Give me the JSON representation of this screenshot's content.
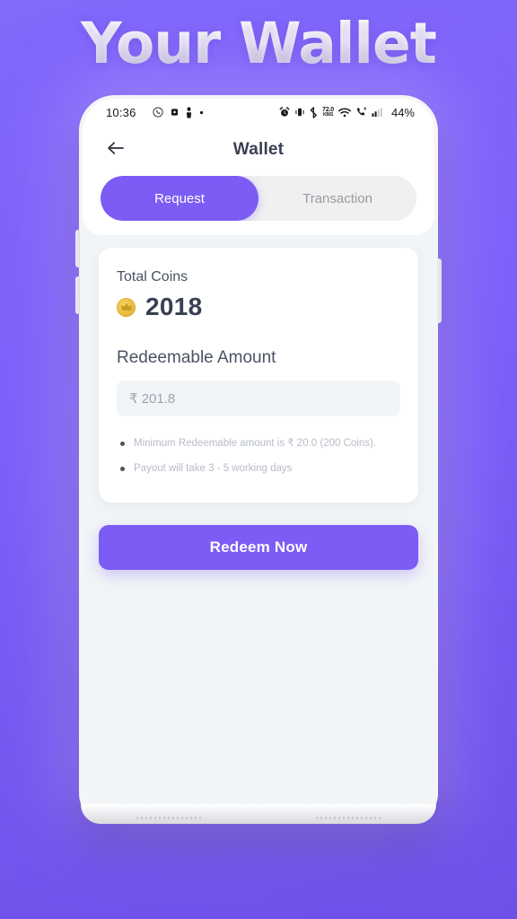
{
  "hero": {
    "title": "Your Wallet"
  },
  "status_bar": {
    "time": "10:36",
    "left_icons": [
      "whatsapp-icon",
      "app-icon",
      "app-icon-2",
      "dot-icon"
    ],
    "network_speed_value": "72.0",
    "network_speed_unit": "KB/S",
    "right_icons": [
      "alarm-icon",
      "vibrate-icon",
      "bluetooth-icon",
      "wifi-icon",
      "volte-call-icon",
      "signal-icon"
    ],
    "battery_percent": "44%"
  },
  "header": {
    "back_icon": "arrow-left-icon",
    "title": "Wallet"
  },
  "tabs": [
    {
      "label": "Request",
      "active": true
    },
    {
      "label": "Transaction",
      "active": false
    }
  ],
  "wallet_card": {
    "total_coins_label": "Total Coins",
    "coin_icon": "gold-coin-icon",
    "total_coins_value": "2018",
    "redeemable_label": "Redeemable Amount",
    "amount_value": "₹ 201.8",
    "amount_placeholder": "₹ 201.8",
    "notes": [
      "Minimum Redeemable amount is ₹ 20.0 (200 Coins).",
      "Payout will take 3 - 5 working days"
    ]
  },
  "actions": {
    "redeem_label": "Redeem Now"
  },
  "colors": {
    "brand_purple": "#7c5cf5",
    "background_purple": "#7f63fa",
    "screen_background": "#f2f5f7",
    "coin_gold": "#e9b83c",
    "text_dark": "#3a3f52",
    "text_muted": "#b7bcc6"
  }
}
